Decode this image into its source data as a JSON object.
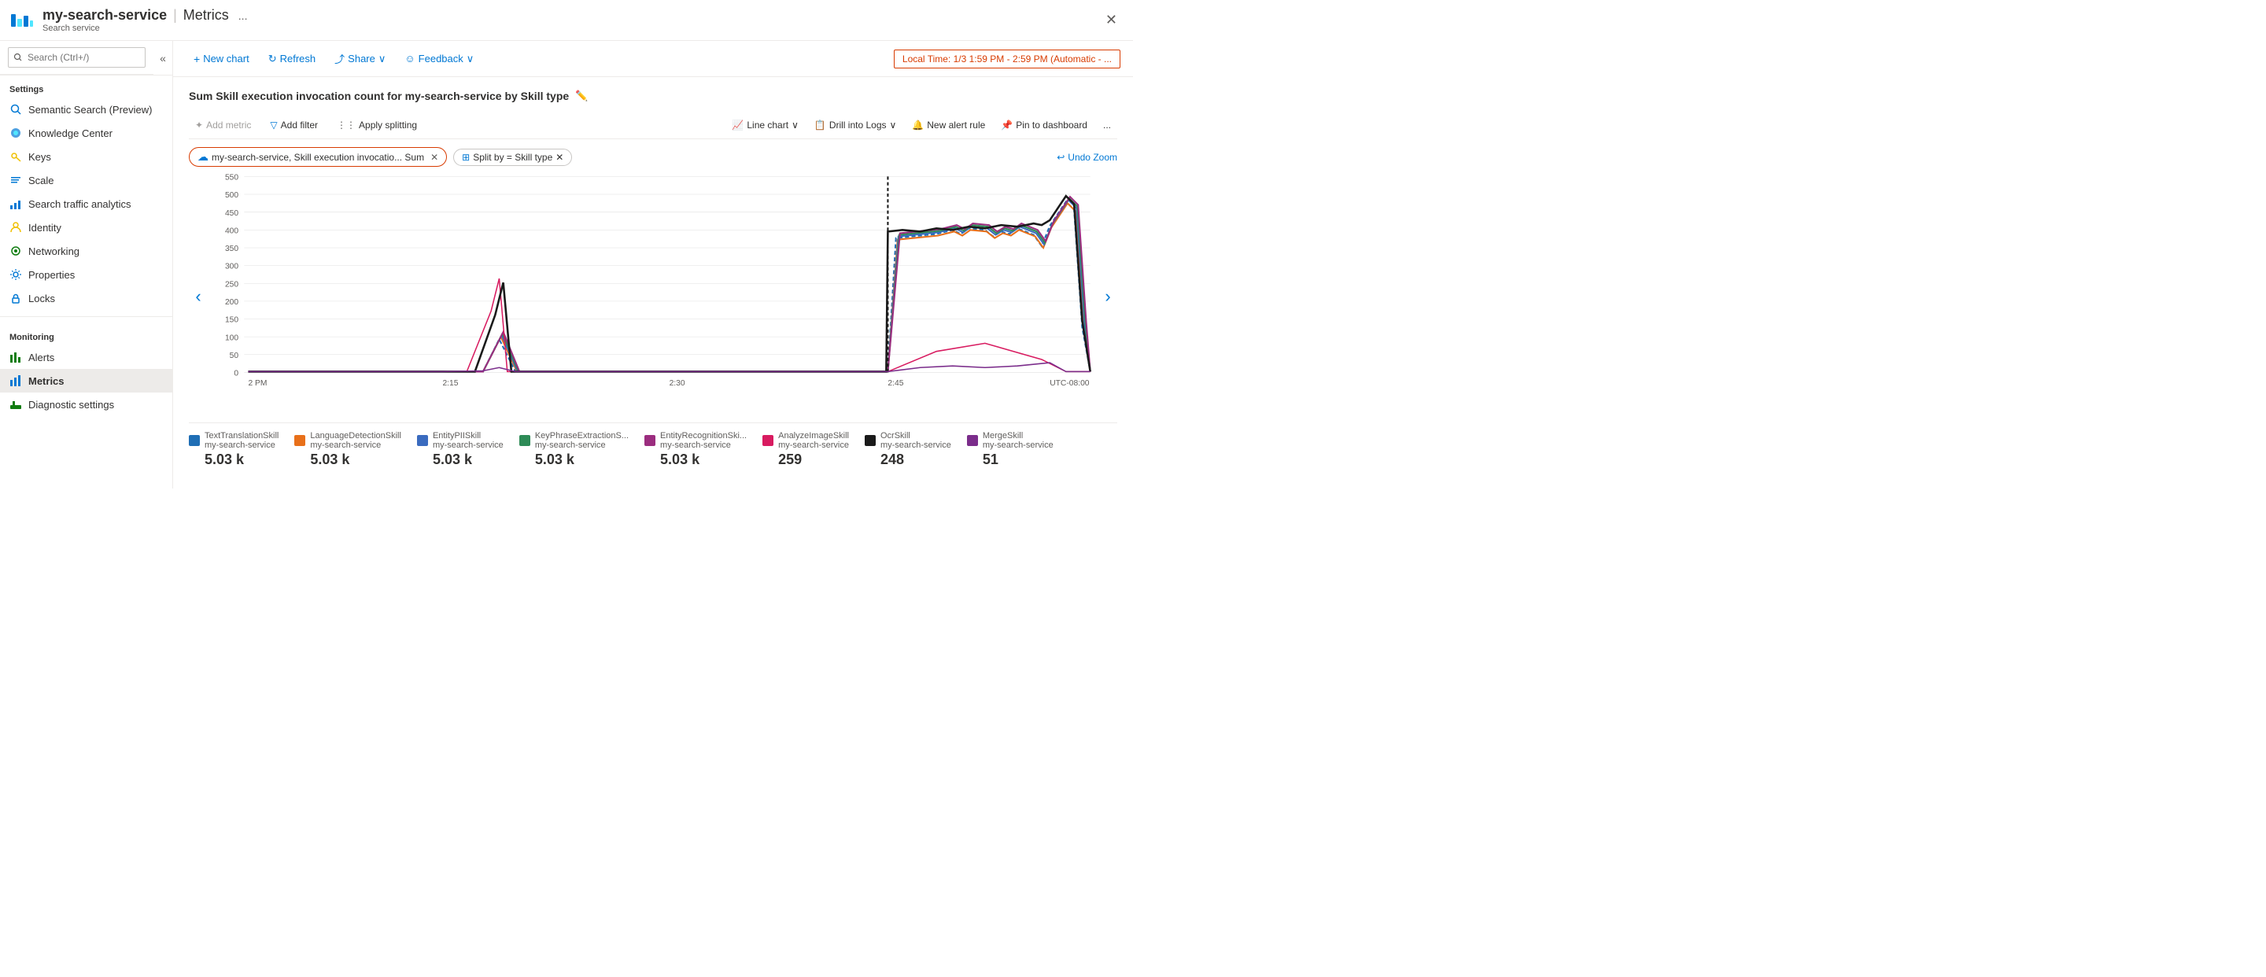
{
  "titleBar": {
    "service": "my-search-service",
    "separator": "|",
    "page": "Metrics",
    "subtitle": "Search service",
    "dotsLabel": "...",
    "closeLabel": "✕"
  },
  "sidebar": {
    "searchPlaceholder": "Search (Ctrl+/)",
    "collapseIcon": "«",
    "sections": [
      {
        "label": "Settings",
        "items": [
          {
            "id": "semantic-search",
            "label": "Semantic Search (Preview)",
            "icon": "🔍"
          },
          {
            "id": "knowledge-center",
            "label": "Knowledge Center",
            "icon": "🔵"
          },
          {
            "id": "keys",
            "label": "Keys",
            "icon": "🔑"
          },
          {
            "id": "scale",
            "label": "Scale",
            "icon": "📝"
          },
          {
            "id": "search-traffic",
            "label": "Search traffic analytics",
            "icon": "📊"
          },
          {
            "id": "identity",
            "label": "Identity",
            "icon": "💛"
          },
          {
            "id": "networking",
            "label": "Networking",
            "icon": "🟢"
          },
          {
            "id": "properties",
            "label": "Properties",
            "icon": "⚙️"
          },
          {
            "id": "locks",
            "label": "Locks",
            "icon": "🔒"
          }
        ]
      },
      {
        "label": "Monitoring",
        "items": [
          {
            "id": "alerts",
            "label": "Alerts",
            "icon": "🔔"
          },
          {
            "id": "metrics",
            "label": "Metrics",
            "icon": "📈",
            "active": true
          },
          {
            "id": "diagnostic",
            "label": "Diagnostic settings",
            "icon": "🟩"
          }
        ]
      }
    ]
  },
  "toolbar": {
    "newChartLabel": "New chart",
    "refreshLabel": "Refresh",
    "shareLabel": "Share",
    "feedbackLabel": "Feedback",
    "timeRange": "Local Time: 1/3 1:59 PM - 2:59 PM (Automatic - ..."
  },
  "chartTitle": "Sum Skill execution invocation count for my-search-service by Skill type",
  "chartToolbar": {
    "addMetric": "Add metric",
    "addFilter": "Add filter",
    "applySplitting": "Apply splitting",
    "lineChart": "Line chart",
    "drillIntoLogs": "Drill into Logs",
    "newAlertRule": "New alert rule",
    "pinToDashboard": "Pin to dashboard",
    "moreOptions": "..."
  },
  "metricTag": {
    "icon": "☁",
    "label": "my-search-service, Skill execution invocatio... Sum",
    "closeIcon": "✕"
  },
  "splitTag": {
    "icon": "⊞",
    "label": "Split by = Skill type",
    "closeIcon": "✕"
  },
  "undoZoom": "Undo Zoom",
  "chart": {
    "yLabels": [
      "550",
      "500",
      "450",
      "400",
      "350",
      "300",
      "250",
      "200",
      "150",
      "100",
      "50",
      "0"
    ],
    "xLabels": [
      "2 PM",
      "2:15",
      "2:30",
      "2:45",
      "UTC-08:00"
    ],
    "timezone": "UTC-08:00"
  },
  "legend": [
    {
      "id": "text-translation",
      "name": "TextTranslationSkill",
      "service": "my-search-service",
      "value": "5.03 k",
      "color": "#1f6eb5"
    },
    {
      "id": "language-detection",
      "name": "LanguageDetectionSkill",
      "service": "my-search-service",
      "value": "5.03 k",
      "color": "#e8701a"
    },
    {
      "id": "entity-pii",
      "name": "EntityPIISkill",
      "service": "my-search-service",
      "value": "5.03 k",
      "color": "#3a6bbf"
    },
    {
      "id": "key-phrase",
      "name": "KeyPhraseExtractionS...",
      "service": "my-search-service",
      "value": "5.03 k",
      "color": "#2e8b57"
    },
    {
      "id": "entity-recognition",
      "name": "EntityRecognitionSki...",
      "service": "my-search-service",
      "value": "5.03 k",
      "color": "#9b2d7f"
    },
    {
      "id": "analyze-image",
      "name": "AnalyzeImageSkill",
      "service": "my-search-service",
      "value": "259",
      "color": "#d81b60"
    },
    {
      "id": "ocr-skill",
      "name": "OcrSkill",
      "service": "my-search-service",
      "value": "248",
      "color": "#1a1a1a"
    },
    {
      "id": "merge-skill",
      "name": "MergeSkill",
      "service": "my-search-service",
      "value": "51",
      "color": "#7b2d8b"
    }
  ],
  "navArrows": {
    "left": "‹",
    "right": "›"
  }
}
